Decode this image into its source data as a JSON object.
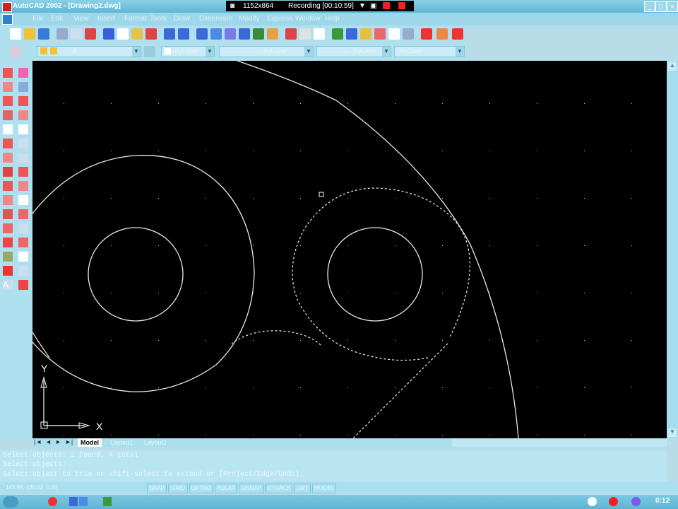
{
  "window": {
    "title": "AutoCAD 2002 - [Drawing2.dwg]",
    "min": "_",
    "max": "□",
    "close": "×"
  },
  "recorder": {
    "resolution": "1152x864",
    "status": "Recording [00:10:59]"
  },
  "menu": [
    "File",
    "Edit",
    "View",
    "Insert",
    "Format",
    "Tools",
    "Draw",
    "Dimension",
    "Modify",
    "Express",
    "Window",
    "Help"
  ],
  "toolbar2": {
    "layer": "0",
    "color": "ByLayer",
    "linetype": "ByLayer",
    "lineweight": "ByLayer",
    "plotstyle": "ByColor"
  },
  "canvas": {
    "ucs_x": "X",
    "ucs_y": "Y"
  },
  "tabs": [
    "Model",
    "Layout1",
    "Layout2"
  ],
  "command": {
    "line1": "Select objects: 1 found, 4 total",
    "line2": "Select objects:",
    "line3": "Select object to trim or shift-select to extend or [Project/Edge/Undo]:"
  },
  "status": {
    "coords": "143.86, 130.62, 0.00",
    "toggles": [
      "SNAP",
      "GRID",
      "ORTHO",
      "POLAR",
      "OSNAP",
      "OTRACK",
      "LWT",
      "MODEL"
    ]
  },
  "taskbar": {
    "clock": "0:12"
  }
}
